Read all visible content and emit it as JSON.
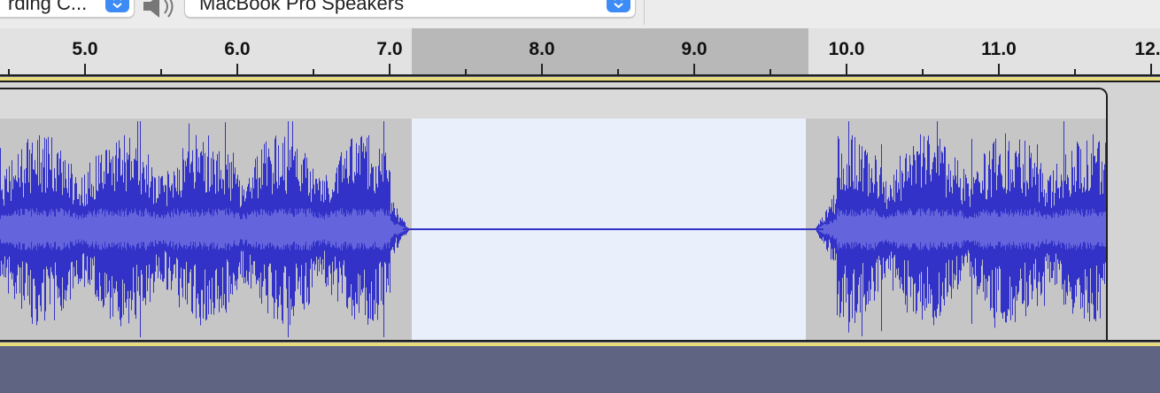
{
  "toolbar": {
    "recording_device": "rding C...",
    "playback_device": "MacBook Pro Speakers",
    "speaker_icon": "speaker-icon",
    "dropdown_icon": "chevron-updown-icon"
  },
  "ruler": {
    "labels": [
      "5.0",
      "6.0",
      "7.0",
      "8.0",
      "9.0",
      "10.0",
      "11.0",
      "12."
    ],
    "unit": "seconds",
    "selection_start": 7.2,
    "selection_end": 9.8
  },
  "colors": {
    "waveform": "#3232c8",
    "waveform_rms": "#6464dc",
    "selection": "#eaf0fb",
    "track_background": "#c6c6c6",
    "bottom_background": "#5f6483"
  }
}
